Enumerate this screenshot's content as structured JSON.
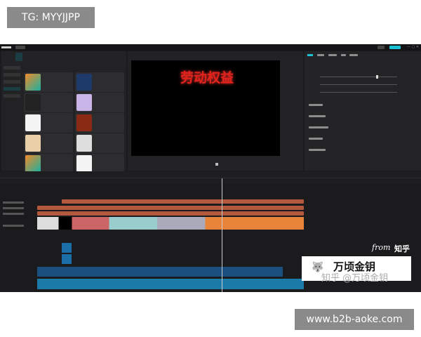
{
  "overlay": {
    "top_label": "TG: MYYJJPP",
    "bottom_label": "www.b2b-aoke.com"
  },
  "preview": {
    "title_text": "劳动权益"
  },
  "watermark": {
    "from": "from",
    "source": "知乎",
    "brand": "万顷金钥",
    "handle": "知乎 @万顷金钥"
  },
  "colors": {
    "accent": "#19c1d3",
    "title_red": "#e0231b",
    "clip_orange": "#b4593d",
    "video_teal": "#175f6a",
    "audio_blue": "#1b4f80"
  }
}
